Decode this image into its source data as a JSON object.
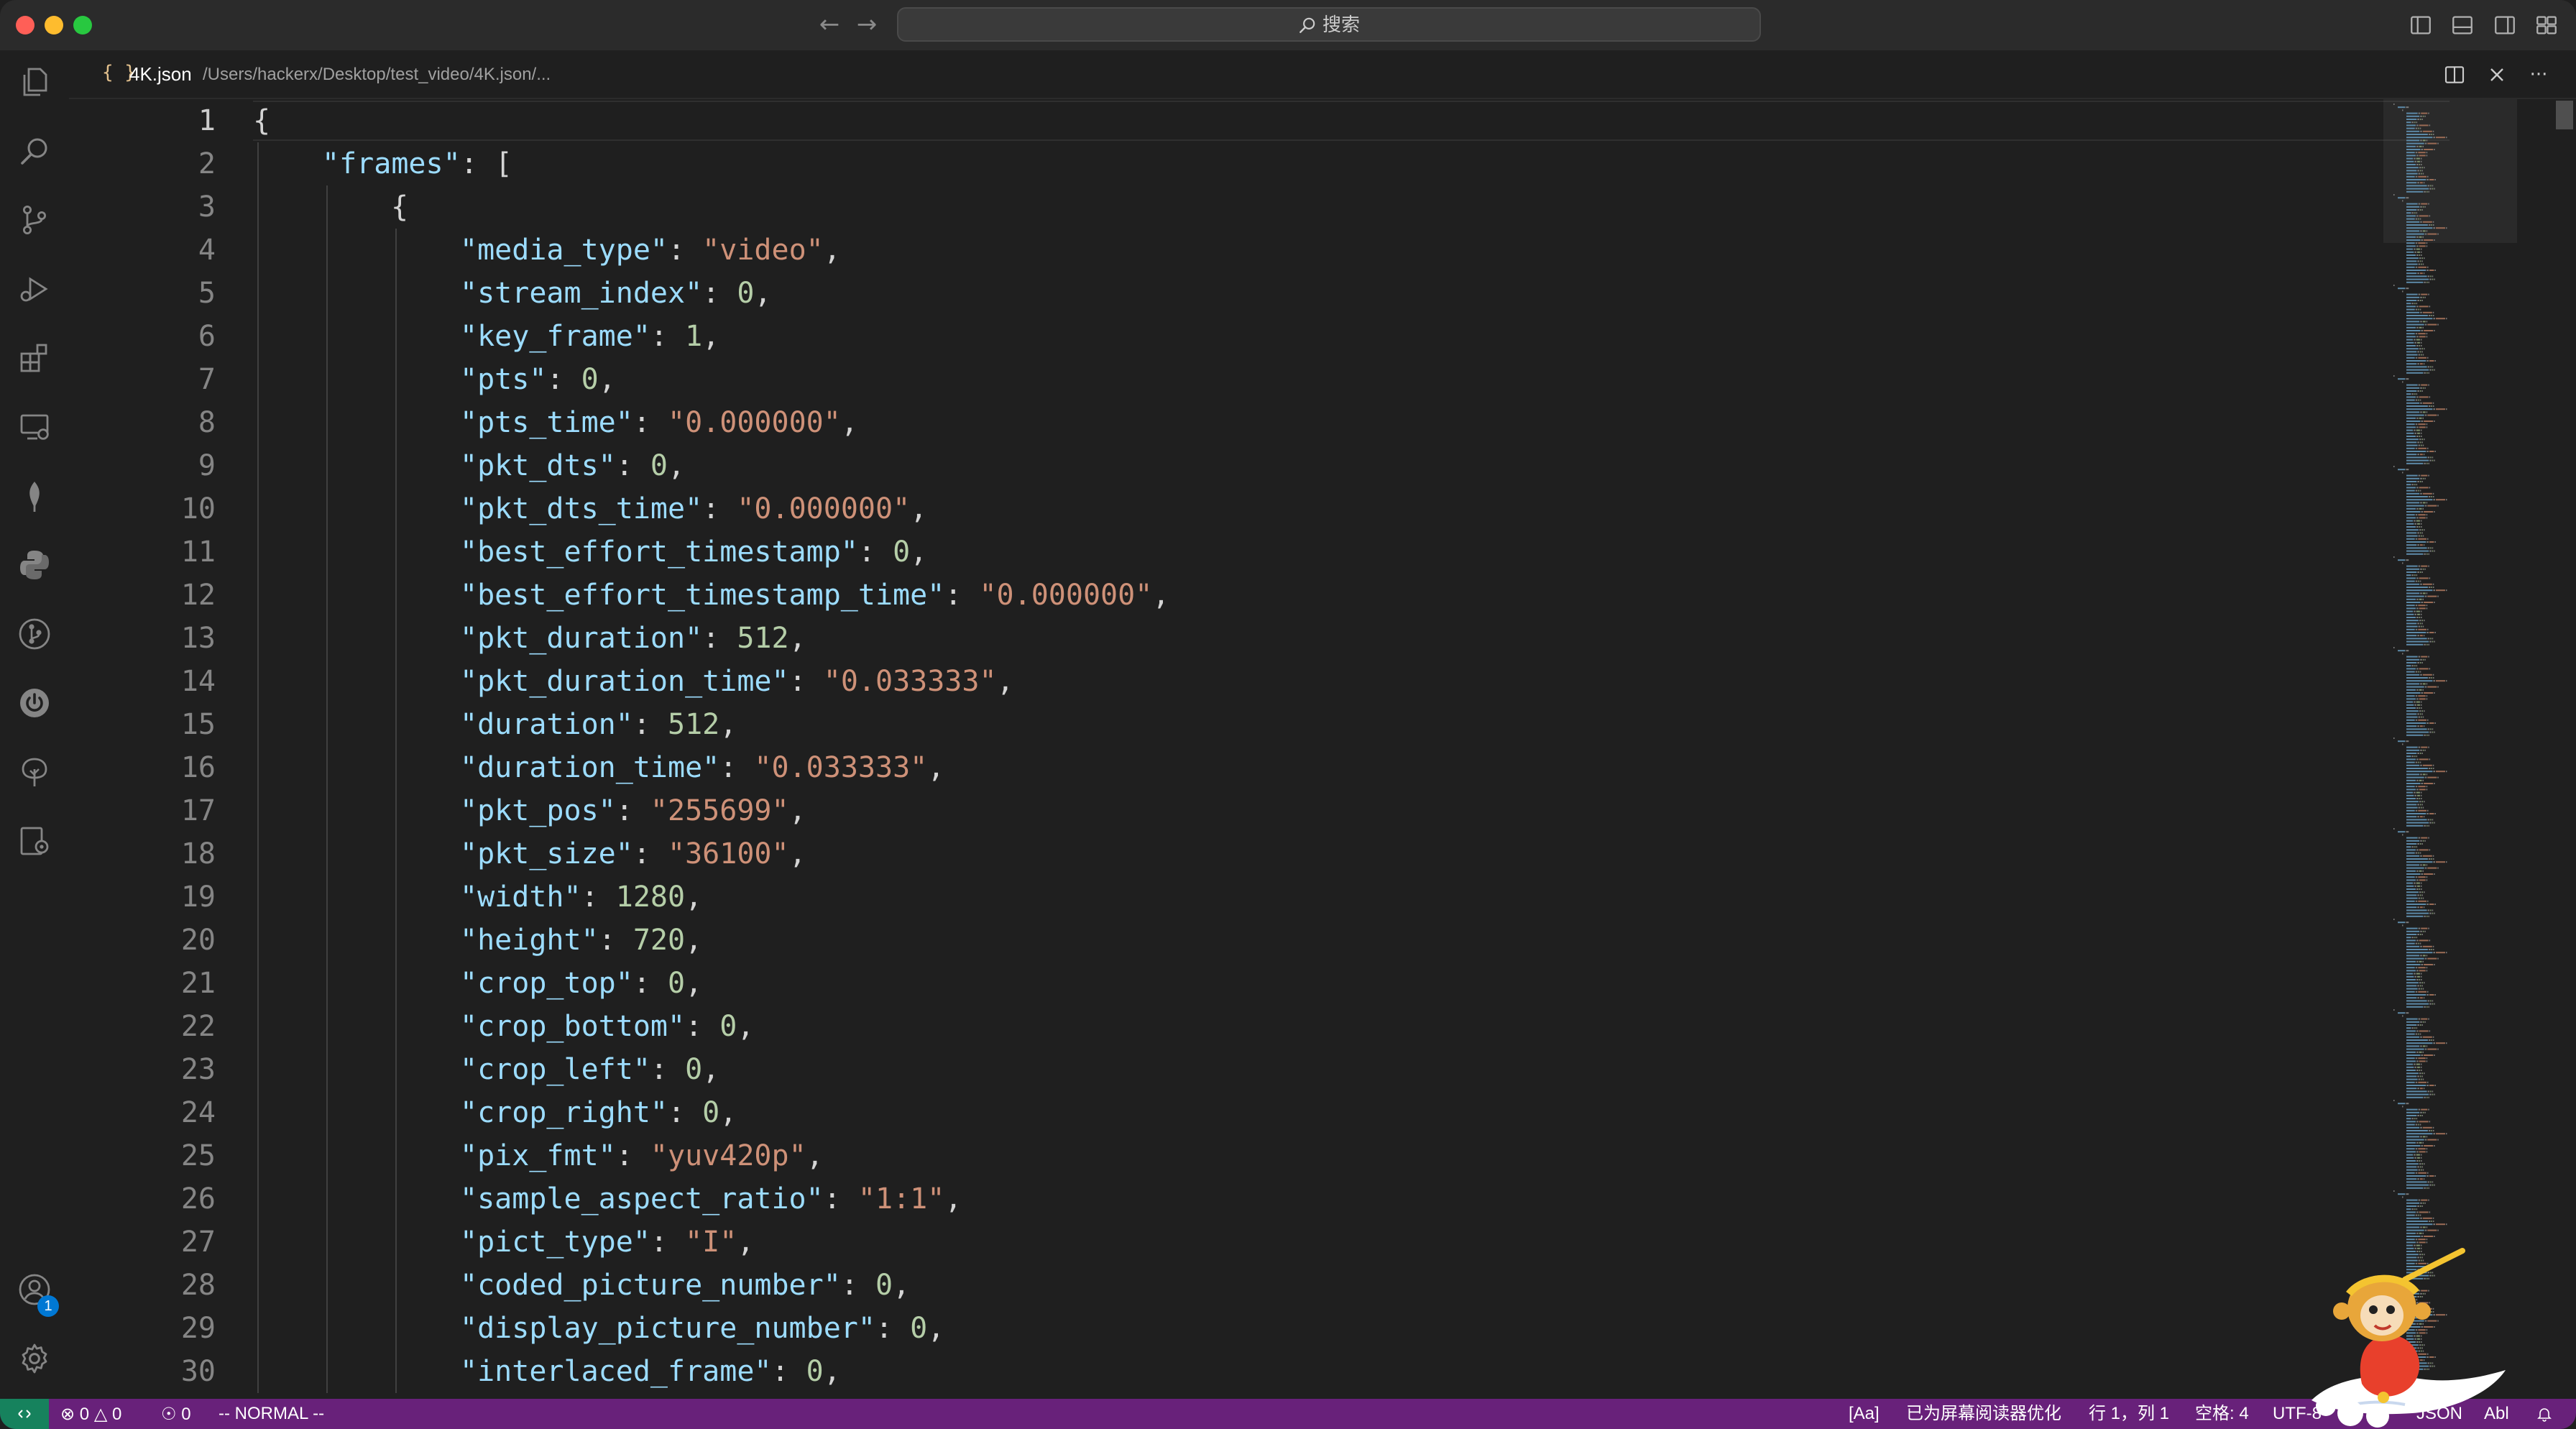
{
  "titlebar": {
    "search_label": "搜索"
  },
  "tab": {
    "file_icon": "{ }",
    "file_name": "4K.json",
    "file_path": "/Users/hackerx/Desktop/test_video/4K.json/...",
    "more_label": "···"
  },
  "editor": {
    "lines": [
      {
        "n": "1",
        "indent": 0,
        "tokens": [
          {
            "t": "{",
            "c": "brack"
          }
        ]
      },
      {
        "n": "2",
        "indent": 1,
        "tokens": [
          {
            "t": "\"frames\"",
            "c": "key"
          },
          {
            "t": ": [",
            "c": "punc"
          }
        ]
      },
      {
        "n": "3",
        "indent": 2,
        "tokens": [
          {
            "t": "{",
            "c": "brack"
          }
        ]
      },
      {
        "n": "4",
        "indent": 3,
        "tokens": [
          {
            "t": "\"media_type\"",
            "c": "key"
          },
          {
            "t": ": ",
            "c": "punc"
          },
          {
            "t": "\"video\"",
            "c": "str"
          },
          {
            "t": ",",
            "c": "punc"
          }
        ]
      },
      {
        "n": "5",
        "indent": 3,
        "tokens": [
          {
            "t": "\"stream_index\"",
            "c": "key"
          },
          {
            "t": ": ",
            "c": "punc"
          },
          {
            "t": "0",
            "c": "num"
          },
          {
            "t": ",",
            "c": "punc"
          }
        ]
      },
      {
        "n": "6",
        "indent": 3,
        "tokens": [
          {
            "t": "\"key_frame\"",
            "c": "key"
          },
          {
            "t": ": ",
            "c": "punc"
          },
          {
            "t": "1",
            "c": "num"
          },
          {
            "t": ",",
            "c": "punc"
          }
        ]
      },
      {
        "n": "7",
        "indent": 3,
        "tokens": [
          {
            "t": "\"pts\"",
            "c": "key"
          },
          {
            "t": ": ",
            "c": "punc"
          },
          {
            "t": "0",
            "c": "num"
          },
          {
            "t": ",",
            "c": "punc"
          }
        ]
      },
      {
        "n": "8",
        "indent": 3,
        "tokens": [
          {
            "t": "\"pts_time\"",
            "c": "key"
          },
          {
            "t": ": ",
            "c": "punc"
          },
          {
            "t": "\"0.000000\"",
            "c": "str"
          },
          {
            "t": ",",
            "c": "punc"
          }
        ]
      },
      {
        "n": "9",
        "indent": 3,
        "tokens": [
          {
            "t": "\"pkt_dts\"",
            "c": "key"
          },
          {
            "t": ": ",
            "c": "punc"
          },
          {
            "t": "0",
            "c": "num"
          },
          {
            "t": ",",
            "c": "punc"
          }
        ]
      },
      {
        "n": "10",
        "indent": 3,
        "tokens": [
          {
            "t": "\"pkt_dts_time\"",
            "c": "key"
          },
          {
            "t": ": ",
            "c": "punc"
          },
          {
            "t": "\"0.000000\"",
            "c": "str"
          },
          {
            "t": ",",
            "c": "punc"
          }
        ]
      },
      {
        "n": "11",
        "indent": 3,
        "tokens": [
          {
            "t": "\"best_effort_timestamp\"",
            "c": "key"
          },
          {
            "t": ": ",
            "c": "punc"
          },
          {
            "t": "0",
            "c": "num"
          },
          {
            "t": ",",
            "c": "punc"
          }
        ]
      },
      {
        "n": "12",
        "indent": 3,
        "tokens": [
          {
            "t": "\"best_effort_timestamp_time\"",
            "c": "key"
          },
          {
            "t": ": ",
            "c": "punc"
          },
          {
            "t": "\"0.000000\"",
            "c": "str"
          },
          {
            "t": ",",
            "c": "punc"
          }
        ]
      },
      {
        "n": "13",
        "indent": 3,
        "tokens": [
          {
            "t": "\"pkt_duration\"",
            "c": "key"
          },
          {
            "t": ": ",
            "c": "punc"
          },
          {
            "t": "512",
            "c": "num"
          },
          {
            "t": ",",
            "c": "punc"
          }
        ]
      },
      {
        "n": "14",
        "indent": 3,
        "tokens": [
          {
            "t": "\"pkt_duration_time\"",
            "c": "key"
          },
          {
            "t": ": ",
            "c": "punc"
          },
          {
            "t": "\"0.033333\"",
            "c": "str"
          },
          {
            "t": ",",
            "c": "punc"
          }
        ]
      },
      {
        "n": "15",
        "indent": 3,
        "tokens": [
          {
            "t": "\"duration\"",
            "c": "key"
          },
          {
            "t": ": ",
            "c": "punc"
          },
          {
            "t": "512",
            "c": "num"
          },
          {
            "t": ",",
            "c": "punc"
          }
        ]
      },
      {
        "n": "16",
        "indent": 3,
        "tokens": [
          {
            "t": "\"duration_time\"",
            "c": "key"
          },
          {
            "t": ": ",
            "c": "punc"
          },
          {
            "t": "\"0.033333\"",
            "c": "str"
          },
          {
            "t": ",",
            "c": "punc"
          }
        ]
      },
      {
        "n": "17",
        "indent": 3,
        "tokens": [
          {
            "t": "\"pkt_pos\"",
            "c": "key"
          },
          {
            "t": ": ",
            "c": "punc"
          },
          {
            "t": "\"255699\"",
            "c": "str"
          },
          {
            "t": ",",
            "c": "punc"
          }
        ]
      },
      {
        "n": "18",
        "indent": 3,
        "tokens": [
          {
            "t": "\"pkt_size\"",
            "c": "key"
          },
          {
            "t": ": ",
            "c": "punc"
          },
          {
            "t": "\"36100\"",
            "c": "str"
          },
          {
            "t": ",",
            "c": "punc"
          }
        ]
      },
      {
        "n": "19",
        "indent": 3,
        "tokens": [
          {
            "t": "\"width\"",
            "c": "key"
          },
          {
            "t": ": ",
            "c": "punc"
          },
          {
            "t": "1280",
            "c": "num"
          },
          {
            "t": ",",
            "c": "punc"
          }
        ]
      },
      {
        "n": "20",
        "indent": 3,
        "tokens": [
          {
            "t": "\"height\"",
            "c": "key"
          },
          {
            "t": ": ",
            "c": "punc"
          },
          {
            "t": "720",
            "c": "num"
          },
          {
            "t": ",",
            "c": "punc"
          }
        ]
      },
      {
        "n": "21",
        "indent": 3,
        "tokens": [
          {
            "t": "\"crop_top\"",
            "c": "key"
          },
          {
            "t": ": ",
            "c": "punc"
          },
          {
            "t": "0",
            "c": "num"
          },
          {
            "t": ",",
            "c": "punc"
          }
        ]
      },
      {
        "n": "22",
        "indent": 3,
        "tokens": [
          {
            "t": "\"crop_bottom\"",
            "c": "key"
          },
          {
            "t": ": ",
            "c": "punc"
          },
          {
            "t": "0",
            "c": "num"
          },
          {
            "t": ",",
            "c": "punc"
          }
        ]
      },
      {
        "n": "23",
        "indent": 3,
        "tokens": [
          {
            "t": "\"crop_left\"",
            "c": "key"
          },
          {
            "t": ": ",
            "c": "punc"
          },
          {
            "t": "0",
            "c": "num"
          },
          {
            "t": ",",
            "c": "punc"
          }
        ]
      },
      {
        "n": "24",
        "indent": 3,
        "tokens": [
          {
            "t": "\"crop_right\"",
            "c": "key"
          },
          {
            "t": ": ",
            "c": "punc"
          },
          {
            "t": "0",
            "c": "num"
          },
          {
            "t": ",",
            "c": "punc"
          }
        ]
      },
      {
        "n": "25",
        "indent": 3,
        "tokens": [
          {
            "t": "\"pix_fmt\"",
            "c": "key"
          },
          {
            "t": ": ",
            "c": "punc"
          },
          {
            "t": "\"yuv420p\"",
            "c": "str"
          },
          {
            "t": ",",
            "c": "punc"
          }
        ]
      },
      {
        "n": "26",
        "indent": 3,
        "tokens": [
          {
            "t": "\"sample_aspect_ratio\"",
            "c": "key"
          },
          {
            "t": ": ",
            "c": "punc"
          },
          {
            "t": "\"1:1\"",
            "c": "str"
          },
          {
            "t": ",",
            "c": "punc"
          }
        ]
      },
      {
        "n": "27",
        "indent": 3,
        "tokens": [
          {
            "t": "\"pict_type\"",
            "c": "key"
          },
          {
            "t": ": ",
            "c": "punc"
          },
          {
            "t": "\"I\"",
            "c": "str"
          },
          {
            "t": ",",
            "c": "punc"
          }
        ]
      },
      {
        "n": "28",
        "indent": 3,
        "tokens": [
          {
            "t": "\"coded_picture_number\"",
            "c": "key"
          },
          {
            "t": ": ",
            "c": "punc"
          },
          {
            "t": "0",
            "c": "num"
          },
          {
            "t": ",",
            "c": "punc"
          }
        ]
      },
      {
        "n": "29",
        "indent": 3,
        "tokens": [
          {
            "t": "\"display_picture_number\"",
            "c": "key"
          },
          {
            "t": ": ",
            "c": "punc"
          },
          {
            "t": "0",
            "c": "num"
          },
          {
            "t": ",",
            "c": "punc"
          }
        ]
      },
      {
        "n": "30",
        "indent": 3,
        "tokens": [
          {
            "t": "\"interlaced_frame\"",
            "c": "key"
          },
          {
            "t": ": ",
            "c": "punc"
          },
          {
            "t": "0",
            "c": "num"
          },
          {
            "t": ",",
            "c": "punc"
          }
        ]
      }
    ]
  },
  "activity_bar": {
    "icons": [
      "explorer-icon",
      "search-icon",
      "source-control-icon",
      "run-debug-icon",
      "extensions-icon",
      "remote-explorer-icon",
      "mongodb-leaf-icon",
      "python-icon",
      "git-graph-icon",
      "power-icon",
      "tree-icon",
      "gear-doc-icon"
    ],
    "accounts_badge": "1"
  },
  "statusbar": {
    "errors": "0",
    "warnings": "0",
    "ports": "0",
    "vim_mode": "-- NORMAL --",
    "case_toggle": "[Aa]",
    "screen_reader": "已为屏幕阅读器优化",
    "cursor_position": "行 1，列 1",
    "indent": "空格: 4",
    "encoding": "UTF-8",
    "language": "JSON",
    "spell": "Abl"
  },
  "colors": {
    "statusbar_bg": "#68217a",
    "remote_bg": "#16825d",
    "key_color": "#9cdcfe",
    "string_color": "#ce9178",
    "number_color": "#b5cea8"
  }
}
